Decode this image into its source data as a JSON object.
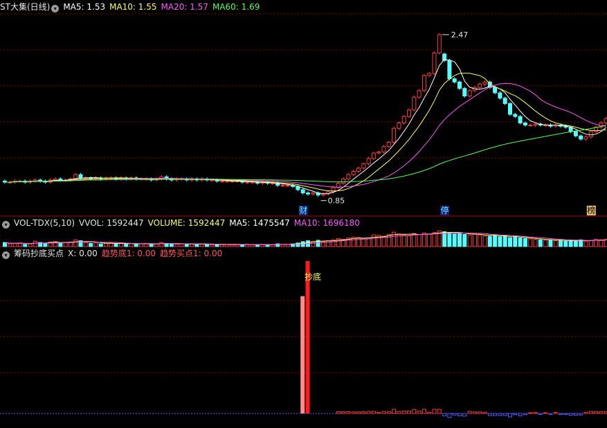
{
  "colors": {
    "bg": "#000000",
    "up": "#ff3c3c",
    "down": "#54ffff",
    "ma5": "#ffffff",
    "ma10": "#ffff55",
    "ma20": "#ff55ff",
    "ma60": "#55ff55",
    "grid": "#8a0000",
    "signal_tall": "#ff1a1a",
    "signal_pink": "#ff8c8c",
    "axis_blue": "#5a5aff"
  },
  "price_panel": {
    "stock": "ST大集(日线)",
    "ma5": "MA5: 1.53",
    "ma10": "MA10: 1.55",
    "ma20": "MA20: 1.57",
    "ma60": "MA60: 1.69",
    "high_label": "2.47",
    "low_label": "0.85",
    "marker_cai": "财",
    "marker_ting": "停",
    "marker_bang": "榜"
  },
  "volume_panel": {
    "name": "VOL-TDX(5,10)",
    "vvol": "VVOL: 1592447",
    "volume": "VOLUME: 1592447",
    "ma5": "MA5: 1475547",
    "ma10": "MA10: 1696180"
  },
  "indicator_panel": {
    "name": "筹码抄底买点",
    "x": "X: 0.00",
    "trend_bottom": "趋势底1: 0.00",
    "trend_buy": "趋势买点1: 0.00",
    "signal_label": "抄底"
  },
  "icons": {
    "collapse": "circle-down-icon"
  },
  "chart_data": [
    {
      "type": "candlestick",
      "title": "ST大集(日线)",
      "ylim": [
        0.78,
        2.6
      ],
      "count": 120,
      "open": [
        1.06,
        1.05,
        1.05,
        1.06,
        1.06,
        1.05,
        1.06,
        1.07,
        1.06,
        1.05,
        1.07,
        1.08,
        1.07,
        1.07,
        1.08,
        1.12,
        1.09,
        1.09,
        1.08,
        1.09,
        1.08,
        1.09,
        1.09,
        1.08,
        1.09,
        1.08,
        1.09,
        1.08,
        1.08,
        1.08,
        1.07,
        1.08,
        1.1,
        1.08,
        1.07,
        1.08,
        1.08,
        1.07,
        1.08,
        1.07,
        1.08,
        1.07,
        1.07,
        1.06,
        1.06,
        1.06,
        1.06,
        1.06,
        1.05,
        1.05,
        1.05,
        1.04,
        1.05,
        1.04,
        1.04,
        1.02,
        1.02,
        1.02,
        1.01,
        0.98,
        0.95,
        0.94,
        0.95,
        0.93,
        0.94,
        0.96,
        1.0,
        1.04,
        1.08,
        1.12,
        1.15,
        1.18,
        1.22,
        1.27,
        1.32,
        1.33,
        1.38,
        1.42,
        1.55,
        1.6,
        1.66,
        1.72,
        1.84,
        1.9,
        2.04,
        2.06,
        2.25,
        2.24,
        2.18,
        2.01,
        1.98,
        1.92,
        1.85,
        1.9,
        1.93,
        1.96,
        1.98,
        1.93,
        1.88,
        1.83,
        1.78,
        1.68,
        1.66,
        1.6,
        1.58,
        1.58,
        1.59,
        1.58,
        1.58,
        1.57,
        1.58,
        1.57,
        1.56,
        1.52,
        1.48,
        1.45,
        1.47,
        1.52,
        1.56,
        1.6
      ],
      "close": [
        1.05,
        1.05,
        1.06,
        1.06,
        1.05,
        1.06,
        1.07,
        1.06,
        1.05,
        1.07,
        1.08,
        1.07,
        1.07,
        1.08,
        1.12,
        1.09,
        1.09,
        1.08,
        1.09,
        1.08,
        1.09,
        1.09,
        1.08,
        1.09,
        1.08,
        1.09,
        1.08,
        1.08,
        1.08,
        1.07,
        1.08,
        1.1,
        1.08,
        1.07,
        1.08,
        1.08,
        1.07,
        1.08,
        1.07,
        1.08,
        1.07,
        1.07,
        1.06,
        1.06,
        1.06,
        1.06,
        1.06,
        1.05,
        1.05,
        1.05,
        1.04,
        1.05,
        1.04,
        1.04,
        1.02,
        1.02,
        1.02,
        1.01,
        0.98,
        0.95,
        0.94,
        0.95,
        0.93,
        0.94,
        0.96,
        1.0,
        1.04,
        1.08,
        1.12,
        1.15,
        1.18,
        1.22,
        1.27,
        1.32,
        1.33,
        1.38,
        1.42,
        1.55,
        1.6,
        1.66,
        1.72,
        1.84,
        1.9,
        2.04,
        2.06,
        2.25,
        2.42,
        2.18,
        2.01,
        1.98,
        1.92,
        1.85,
        1.9,
        1.93,
        1.96,
        1.98,
        1.93,
        1.88,
        1.83,
        1.78,
        1.68,
        1.66,
        1.6,
        1.58,
        1.58,
        1.59,
        1.58,
        1.58,
        1.57,
        1.58,
        1.57,
        1.56,
        1.52,
        1.48,
        1.45,
        1.47,
        1.52,
        1.56,
        1.6,
        1.64
      ]
    },
    {
      "type": "bar",
      "title": "VOL-TDX(5,10)",
      "ylim": [
        0,
        4000000
      ],
      "values": [
        900000,
        600000,
        700000,
        800000,
        500000,
        600000,
        1200000,
        900000,
        700000,
        1000000,
        1100000,
        800000,
        900000,
        1000000,
        1500000,
        1300000,
        900000,
        700000,
        800000,
        600000,
        700000,
        800000,
        600000,
        700000,
        600000,
        700000,
        500000,
        600000,
        700000,
        500000,
        600000,
        900000,
        700000,
        600000,
        500000,
        600000,
        500000,
        600000,
        500000,
        600000,
        500000,
        400000,
        500000,
        400000,
        500000,
        400000,
        500000,
        400000,
        500000,
        400000,
        400000,
        500000,
        400000,
        400000,
        600000,
        500000,
        500000,
        600000,
        800000,
        1100000,
        1300000,
        1200000,
        1400000,
        1100000,
        1300000,
        1500000,
        1800000,
        1600000,
        1900000,
        2100000,
        2000000,
        1700000,
        1900000,
        2600000,
        2500000,
        2300000,
        2700000,
        3200000,
        2800000,
        2600000,
        2400000,
        2900000,
        2700000,
        3000000,
        2800000,
        3100000,
        3500000,
        3300000,
        3100000,
        2800000,
        3000000,
        2700000,
        2500000,
        2800000,
        2600000,
        2400000,
        2300000,
        2500000,
        2200000,
        2400000,
        2000000,
        2100000,
        1900000,
        1800000,
        1700000,
        1600000,
        1500000,
        1400000,
        1500000,
        1300000,
        1400000,
        1200000,
        1400000,
        1300000,
        1500000,
        1200000,
        1300000,
        1600000,
        1500000,
        1600000
      ]
    },
    {
      "type": "bar",
      "title": "筹码抄底买点",
      "ylim": [
        0,
        100
      ],
      "signal_tall_index": 60,
      "signal_tall_value": 100,
      "signal_pink_index": 59,
      "signal_pink_value": 77
    }
  ]
}
